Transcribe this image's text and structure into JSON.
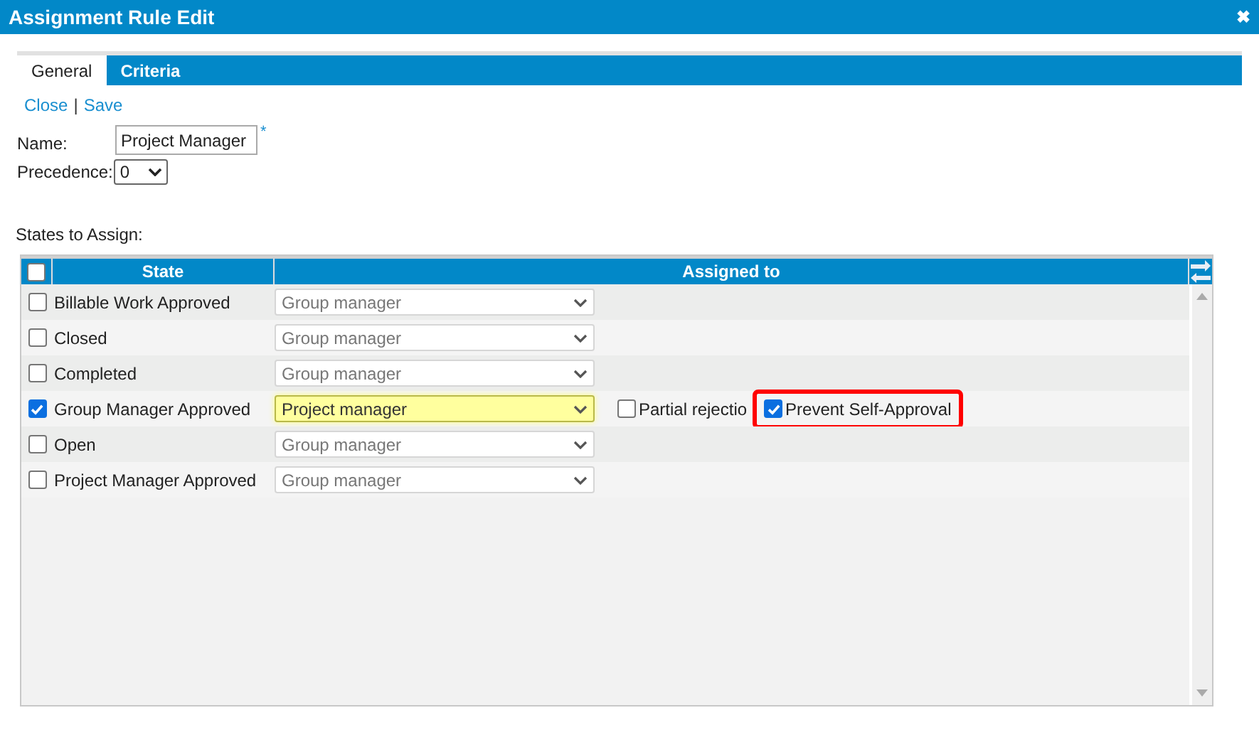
{
  "window": {
    "title": "Assignment Rule Edit",
    "close_glyph": "✖"
  },
  "tabs": [
    {
      "label": "General",
      "selected": true
    },
    {
      "label": "Criteria",
      "selected": false
    }
  ],
  "links": [
    "Close",
    "Save"
  ],
  "link_separator": "|",
  "form": {
    "name_label": "Name:",
    "name_value": "Project Manager",
    "required_mark": "*",
    "precedence_label": "Precedence:",
    "precedence_value": "0"
  },
  "section_label": "States to Assign:",
  "table": {
    "select_all_checked": false,
    "columns": [
      "State",
      "Assigned to"
    ],
    "rows": [
      {
        "state": "Billable Work Approved",
        "checked": false,
        "assigned_to": "Group manager",
        "highlighted": false,
        "options": []
      },
      {
        "state": "Closed",
        "checked": false,
        "assigned_to": "Group manager",
        "highlighted": false,
        "options": []
      },
      {
        "state": "Completed",
        "checked": false,
        "assigned_to": "Group manager",
        "highlighted": false,
        "options": []
      },
      {
        "state": "Group Manager Approved",
        "checked": true,
        "assigned_to": "Project manager",
        "highlighted": true,
        "options": [
          {
            "label": "Partial rejectio",
            "checked": false,
            "outlined": false
          },
          {
            "label": "Prevent Self-Approval",
            "checked": true,
            "outlined": true
          }
        ]
      },
      {
        "state": "Open",
        "checked": false,
        "assigned_to": "Group manager",
        "highlighted": false,
        "options": []
      },
      {
        "state": "Project Manager Approved",
        "checked": false,
        "assigned_to": "Group manager",
        "highlighted": false,
        "options": []
      }
    ]
  }
}
